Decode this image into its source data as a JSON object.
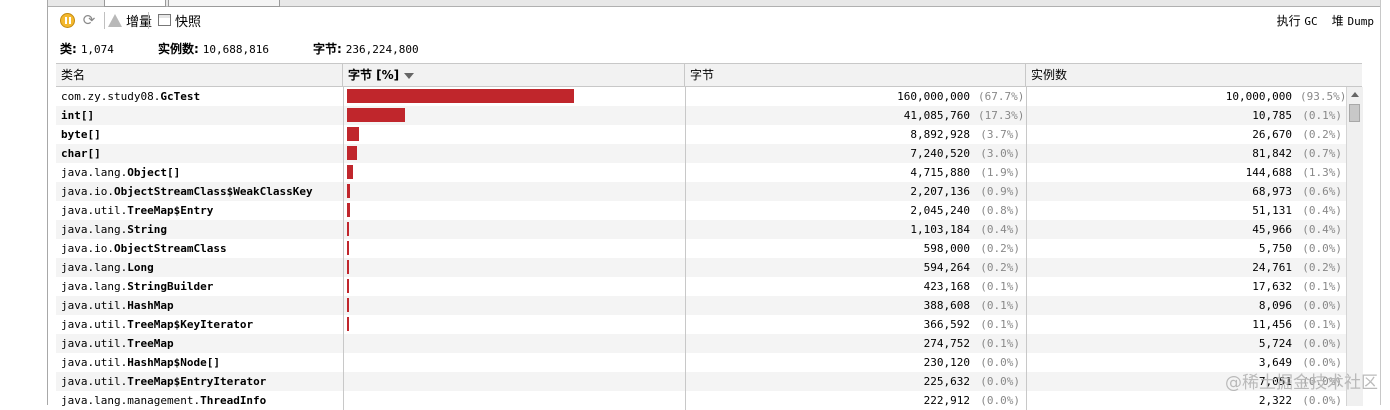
{
  "toolbar": {
    "delta_label": "增量",
    "snapshot_label": "快照",
    "run_gc_label": "执行",
    "run_gc_suffix": "GC",
    "heap_dump_label": "堆",
    "heap_dump_suffix": "Dump",
    "icons": [
      "pause-icon",
      "refresh-icon",
      "delta-icon",
      "snapshot-icon"
    ]
  },
  "summary": {
    "classes_label": "类:",
    "classes_value": "1,074",
    "instances_label": "实例数:",
    "instances_value": "10,688,816",
    "bytes_label": "字节:",
    "bytes_value": "236,224,800"
  },
  "table": {
    "columns": [
      "类名",
      "字节 [%]",
      "字节",
      "实例数"
    ],
    "sorted_column": 1,
    "bar_color": "#c0262c",
    "rows": [
      {
        "pkg": "com.zy.study08.",
        "cls": "GcTest",
        "bytes": "160,000,000",
        "bytes_pct": "(67.7%)",
        "instances": "10,000,000",
        "instances_pct": "(93.5%)",
        "share": 0.677
      },
      {
        "pkg": "",
        "cls": "int[]",
        "bytes": "41,085,760",
        "bytes_pct": "(17.3%)",
        "instances": "10,785",
        "instances_pct": "(0.1%)",
        "share": 0.173
      },
      {
        "pkg": "",
        "cls": "byte[]",
        "bytes": "8,892,928",
        "bytes_pct": "(3.7%)",
        "instances": "26,670",
        "instances_pct": "(0.2%)",
        "share": 0.037
      },
      {
        "pkg": "",
        "cls": "char[]",
        "bytes": "7,240,520",
        "bytes_pct": "(3.0%)",
        "instances": "81,842",
        "instances_pct": "(0.7%)",
        "share": 0.03
      },
      {
        "pkg": "java.lang.",
        "cls": "Object[]",
        "bytes": "4,715,880",
        "bytes_pct": "(1.9%)",
        "instances": "144,688",
        "instances_pct": "(1.3%)",
        "share": 0.019
      },
      {
        "pkg": "java.io.",
        "cls": "ObjectStreamClass$WeakClassKey",
        "bytes": "2,207,136",
        "bytes_pct": "(0.9%)",
        "instances": "68,973",
        "instances_pct": "(0.6%)",
        "share": 0.009
      },
      {
        "pkg": "java.util.",
        "cls": "TreeMap$Entry",
        "bytes": "2,045,240",
        "bytes_pct": "(0.8%)",
        "instances": "51,131",
        "instances_pct": "(0.4%)",
        "share": 0.008
      },
      {
        "pkg": "java.lang.",
        "cls": "String",
        "bytes": "1,103,184",
        "bytes_pct": "(0.4%)",
        "instances": "45,966",
        "instances_pct": "(0.4%)",
        "share": 0.004
      },
      {
        "pkg": "java.io.",
        "cls": "ObjectStreamClass",
        "bytes": "598,000",
        "bytes_pct": "(0.2%)",
        "instances": "5,750",
        "instances_pct": "(0.0%)",
        "share": 0.002
      },
      {
        "pkg": "java.lang.",
        "cls": "Long",
        "bytes": "594,264",
        "bytes_pct": "(0.2%)",
        "instances": "24,761",
        "instances_pct": "(0.2%)",
        "share": 0.002
      },
      {
        "pkg": "java.lang.",
        "cls": "StringBuilder",
        "bytes": "423,168",
        "bytes_pct": "(0.1%)",
        "instances": "17,632",
        "instances_pct": "(0.1%)",
        "share": 0.001
      },
      {
        "pkg": "java.util.",
        "cls": "HashMap",
        "bytes": "388,608",
        "bytes_pct": "(0.1%)",
        "instances": "8,096",
        "instances_pct": "(0.0%)",
        "share": 0.001
      },
      {
        "pkg": "java.util.",
        "cls": "TreeMap$KeyIterator",
        "bytes": "366,592",
        "bytes_pct": "(0.1%)",
        "instances": "11,456",
        "instances_pct": "(0.1%)",
        "share": 0.001
      },
      {
        "pkg": "java.util.",
        "cls": "TreeMap",
        "bytes": "274,752",
        "bytes_pct": "(0.1%)",
        "instances": "5,724",
        "instances_pct": "(0.0%)",
        "share": 0
      },
      {
        "pkg": "java.util.",
        "cls": "HashMap$Node[]",
        "bytes": "230,120",
        "bytes_pct": "(0.0%)",
        "instances": "3,649",
        "instances_pct": "(0.0%)",
        "share": 0
      },
      {
        "pkg": "java.util.",
        "cls": "TreeMap$EntryIterator",
        "bytes": "225,632",
        "bytes_pct": "(0.0%)",
        "instances": "7,051",
        "instances_pct": "(0.0%)",
        "share": 0
      },
      {
        "pkg": "java.lang.management.",
        "cls": "ThreadInfo",
        "bytes": "222,912",
        "bytes_pct": "(0.0%)",
        "instances": "2,322",
        "instances_pct": "(0.0%)",
        "share": 0
      }
    ]
  },
  "watermark": "@稀土掘金技术社区"
}
